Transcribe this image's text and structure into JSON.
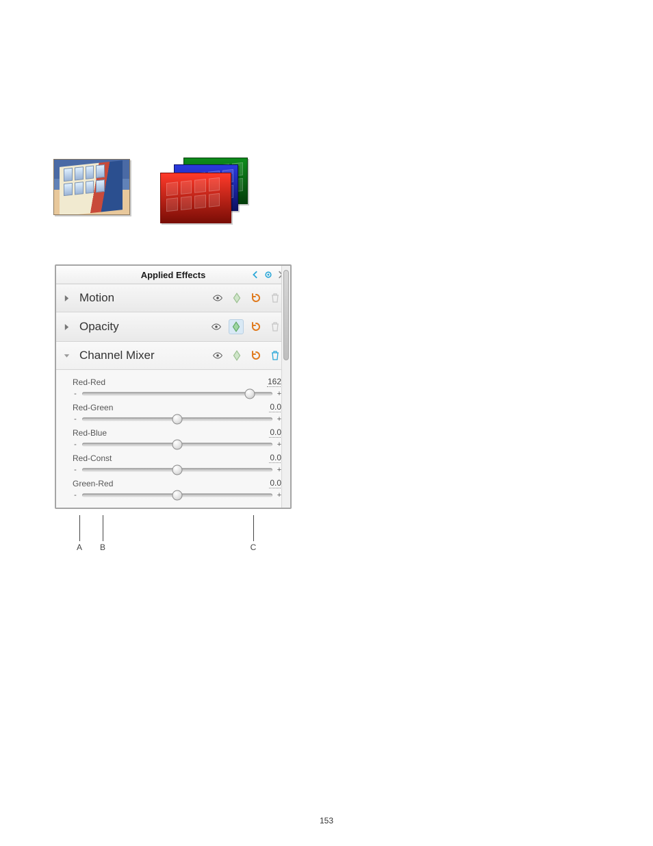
{
  "page_number": "153",
  "header": {
    "title": "Applied Effects"
  },
  "effects": [
    {
      "key": "motion",
      "label": "Motion",
      "expanded": false,
      "keyframe_hl": false,
      "disabled_trash": true
    },
    {
      "key": "opacity",
      "label": "Opacity",
      "expanded": false,
      "keyframe_hl": true,
      "disabled_trash": true
    },
    {
      "key": "channel_mixer",
      "label": "Channel Mixer",
      "expanded": true,
      "keyframe_hl": false,
      "disabled_trash": false
    }
  ],
  "sliders": [
    {
      "key": "red_red",
      "label": "Red-Red",
      "value": "162",
      "pos_pct": 88
    },
    {
      "key": "red_green",
      "label": "Red-Green",
      "value": "0.0",
      "pos_pct": 50
    },
    {
      "key": "red_blue",
      "label": "Red-Blue",
      "value": "0.0",
      "pos_pct": 50
    },
    {
      "key": "red_const",
      "label": "Red-Const",
      "value": "0.0",
      "pos_pct": 50
    },
    {
      "key": "green_red",
      "label": "Green-Red",
      "value": "0.0",
      "pos_pct": 50
    }
  ],
  "callouts": {
    "a": "A",
    "b": "B",
    "c": "C"
  },
  "icons": {
    "minus": "-",
    "plus": "+"
  }
}
